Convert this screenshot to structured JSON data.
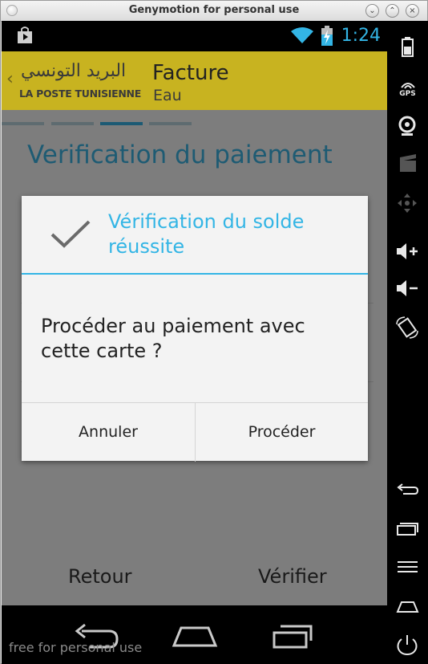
{
  "window": {
    "title": "Genymotion for personal use"
  },
  "statusbar": {
    "time": "1:24"
  },
  "appbar": {
    "logo_ar": "البريد التونسي",
    "logo_en": "LA POSTE TUNISIENNE",
    "title": "Facture",
    "subtitle": "Eau"
  },
  "page": {
    "heading": "Verification du paiement"
  },
  "dialog": {
    "title": "Vérification du solde réussite",
    "message": "Procéder au paiement avec cette carte ?",
    "cancel_label": "Annuler",
    "confirm_label": "Procéder"
  },
  "footer": {
    "back_label": "Retour",
    "verify_label": "Vérifier"
  },
  "watermark": "free for personal use",
  "sidebar": {
    "gps_label": "GPS"
  },
  "colors": {
    "accent": "#33b5e5",
    "appbar": "#c8b320",
    "heading": "#1e5b73"
  }
}
